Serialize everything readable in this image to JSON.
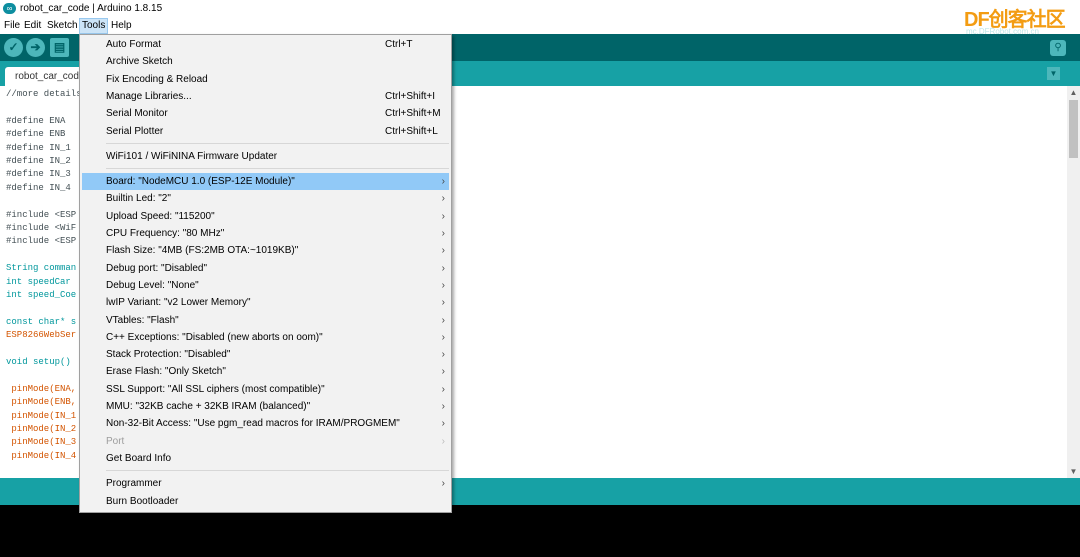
{
  "window": {
    "title": "robot_car_code | Arduino 1.8.15"
  },
  "menubar": [
    "File",
    "Edit",
    "Sketch",
    "Tools",
    "Help"
  ],
  "tab": {
    "label": "robot_car_code"
  },
  "watermark": {
    "logo": "DF创客社区",
    "url": "mc.DFRobot.com.cn"
  },
  "code_lines": [
    {
      "text": "//more details",
      "cls": ""
    },
    {
      "text": "",
      "cls": ""
    },
    {
      "text": "#define ENA",
      "cls": ""
    },
    {
      "text": "#define ENB",
      "cls": ""
    },
    {
      "text": "#define IN_1",
      "cls": ""
    },
    {
      "text": "#define IN_2",
      "cls": ""
    },
    {
      "text": "#define IN_3",
      "cls": ""
    },
    {
      "text": "#define IN_4",
      "cls": ""
    },
    {
      "text": "",
      "cls": ""
    },
    {
      "text": "#include <ESP",
      "cls": ""
    },
    {
      "text": "#include <WiF",
      "cls": ""
    },
    {
      "text": "#include <ESP",
      "cls": ""
    },
    {
      "text": "",
      "cls": ""
    },
    {
      "text": "String comman",
      "cls": "ty"
    },
    {
      "text": "int speedCar",
      "cls": "ty"
    },
    {
      "text": "int speed_Coe",
      "cls": "ty"
    },
    {
      "text": "",
      "cls": ""
    },
    {
      "text": "const char* s",
      "cls": "ty"
    },
    {
      "text": "ESP8266WebSer",
      "cls": "fn"
    },
    {
      "text": "",
      "cls": ""
    },
    {
      "text": "void setup()",
      "cls": "ty"
    },
    {
      "text": "",
      "cls": ""
    },
    {
      "text": " pinMode(ENA,",
      "cls": "fn"
    },
    {
      "text": " pinMode(ENB,",
      "cls": "fn"
    },
    {
      "text": " pinMode(IN_1",
      "cls": "fn"
    },
    {
      "text": " pinMode(IN_2",
      "cls": "fn"
    },
    {
      "text": " pinMode(IN_3",
      "cls": "fn"
    },
    {
      "text": " pinMode(IN_4",
      "cls": "fn"
    }
  ],
  "tools_menu": [
    {
      "label": "Auto Format",
      "shortcut": "Ctrl+T"
    },
    {
      "label": "Archive Sketch"
    },
    {
      "label": "Fix Encoding & Reload"
    },
    {
      "label": "Manage Libraries...",
      "shortcut": "Ctrl+Shift+I"
    },
    {
      "label": "Serial Monitor",
      "shortcut": "Ctrl+Shift+M"
    },
    {
      "label": "Serial Plotter",
      "shortcut": "Ctrl+Shift+L"
    },
    {
      "separator": true
    },
    {
      "label": "WiFi101 / WiFiNINA Firmware Updater"
    },
    {
      "separator": true
    },
    {
      "label": "Board: \"NodeMCU 1.0 (ESP-12E Module)\"",
      "submenu": true,
      "highlight": true
    },
    {
      "label": "Builtin Led: \"2\"",
      "submenu": true
    },
    {
      "label": "Upload Speed: \"115200\"",
      "submenu": true
    },
    {
      "label": "CPU Frequency: \"80 MHz\"",
      "submenu": true
    },
    {
      "label": "Flash Size: \"4MB (FS:2MB OTA:~1019KB)\"",
      "submenu": true
    },
    {
      "label": "Debug port: \"Disabled\"",
      "submenu": true
    },
    {
      "label": "Debug Level: \"None\"",
      "submenu": true
    },
    {
      "label": "lwIP Variant: \"v2 Lower Memory\"",
      "submenu": true
    },
    {
      "label": "VTables: \"Flash\"",
      "submenu": true
    },
    {
      "label": "C++ Exceptions: \"Disabled (new aborts on oom)\"",
      "submenu": true
    },
    {
      "label": "Stack Protection: \"Disabled\"",
      "submenu": true
    },
    {
      "label": "Erase Flash: \"Only Sketch\"",
      "submenu": true
    },
    {
      "label": "SSL Support: \"All SSL ciphers (most compatible)\"",
      "submenu": true
    },
    {
      "label": "MMU: \"32KB cache + 32KB IRAM (balanced)\"",
      "submenu": true
    },
    {
      "label": "Non-32-Bit Access: \"Use pgm_read macros for IRAM/PROGMEM\"",
      "submenu": true
    },
    {
      "label": "Port",
      "submenu": true,
      "disabled": true
    },
    {
      "label": "Get Board Info"
    },
    {
      "separator": true
    },
    {
      "label": "Programmer",
      "submenu": true
    },
    {
      "label": "Burn Bootloader"
    }
  ],
  "icons": {
    "verify": "check-icon",
    "upload": "arrow-right-icon",
    "new": "new-file-icon",
    "serial": "magnifier-icon",
    "submenu": "chevron-right-icon"
  },
  "colors": {
    "toolbar": "#006468",
    "tabbar": "#17a1a5",
    "menu_highlight": "#91c9f7"
  }
}
